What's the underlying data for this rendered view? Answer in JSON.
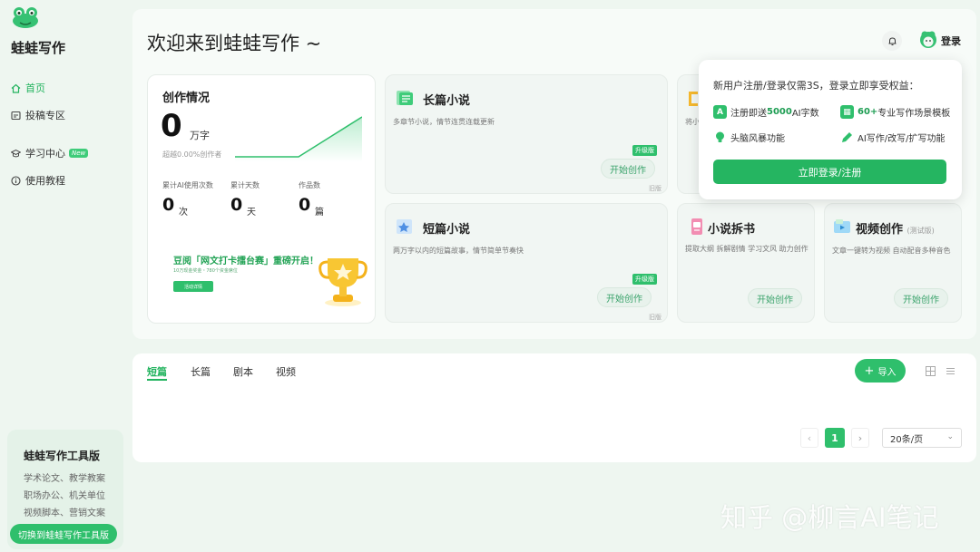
{
  "sidebar": {
    "brand": "蛙蛙写作",
    "items": [
      {
        "label": "首页"
      },
      {
        "label": "投稿专区"
      },
      {
        "label": "学习中心",
        "badge": "New"
      },
      {
        "label": "使用教程"
      }
    ],
    "tool_promo": {
      "title": "蛙蛙写作工具版",
      "lines": [
        "学术论文、教学教案",
        "职场办公、机关单位",
        "视频脚本、营销文案"
      ],
      "button": "切换到蛙蛙写作工具版"
    }
  },
  "header": {
    "title": "欢迎来到蛙蛙写作 ~",
    "login": "登录"
  },
  "stats": {
    "title": "创作情况",
    "words": "0",
    "words_unit": "万字",
    "exceed": "超越0.00%创作者",
    "items": [
      {
        "label": "累计AI使用次数",
        "value": "0",
        "unit": "次"
      },
      {
        "label": "累计天数",
        "value": "0",
        "unit": "天"
      },
      {
        "label": "作品数",
        "value": "0",
        "unit": "篇"
      }
    ],
    "trend": [
      0,
      0,
      0,
      0.5,
      1
    ],
    "promo": {
      "title": "豆阅「网文打卡擂台赛」重磅开启！",
      "subtitle": "10万现金奖金・780个资金席位",
      "button": "活动详情"
    }
  },
  "cards": {
    "long": {
      "title": "长篇小说",
      "desc": "多章节小说，情节连贯连载更新",
      "button": "开始创作",
      "badge": "升级版",
      "version": "旧版"
    },
    "short": {
      "title": "短篇小说",
      "desc": "两万字以内的短篇故事，情节简单节奏快",
      "button": "开始创作",
      "badge": "升级版",
      "version": "旧版"
    },
    "hidden_desc_fragment": "将小",
    "split": {
      "title": "小说拆书",
      "desc": "提取大纲 拆解剧情 学习文风 助力创作",
      "button": "开始创作"
    },
    "video": {
      "title": "视频创作",
      "tag": "(测试版)",
      "desc": "文章一键转为视频 自动配音多种音色",
      "button": "开始创作"
    }
  },
  "login_popup": {
    "title": "新用户注册/登录仅需3S，登录立即享受权益：",
    "b1_pre": "注册即送",
    "b1_hl": "5000",
    "b1_post": "AI字数",
    "b2_hl": "60+",
    "b2_post": "专业写作场景模板",
    "b3": "头脑风暴功能",
    "b4": "AI写作/改写/扩写功能",
    "button": "立即登录/注册"
  },
  "works": {
    "tabs": [
      "短篇",
      "长篇",
      "剧本",
      "视频"
    ],
    "import": "导入",
    "pagination": {
      "current": "1",
      "page_size": "20条/页"
    }
  },
  "watermark": "知乎 @柳言AI笔记",
  "colors": {
    "accent": "#2fbf6c",
    "accent_dark": "#22b35e",
    "background": "#eef6f0"
  }
}
